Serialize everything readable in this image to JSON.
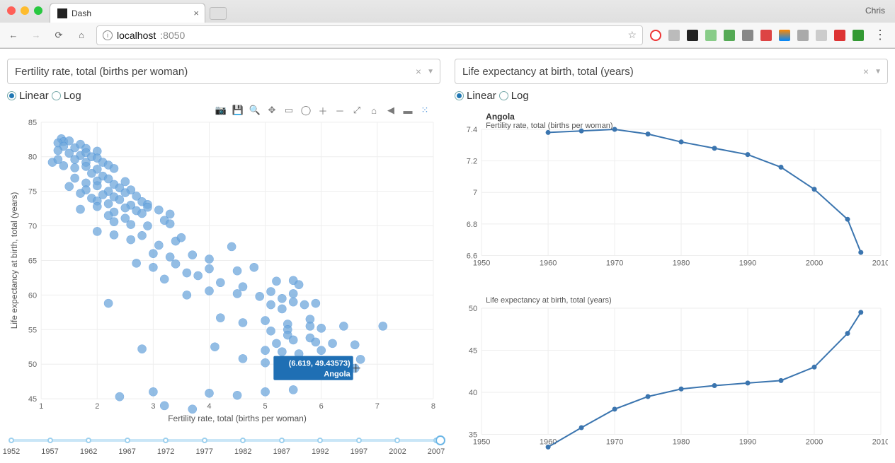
{
  "browser": {
    "tab_title": "Dash",
    "user": "Chris",
    "url_host": "localhost",
    "url_port": ":8050"
  },
  "left": {
    "dropdown": "Fertility rate, total (births per woman)",
    "radio_linear": "Linear",
    "radio_log": "Log",
    "xlabel": "Fertility rate, total (births per woman)",
    "ylabel": "Life expectancy at birth, total (years)",
    "tooltip_line1": "(6.619, 49.43573)",
    "tooltip_line2": "Angola"
  },
  "right": {
    "dropdown": "Life expectancy at birth, total (years)",
    "radio_linear": "Linear",
    "radio_log": "Log",
    "country": "Angola",
    "sub_fert": "Fertility rate, total (births per woman)",
    "sub_life": "Life expectancy at birth, total (years)"
  },
  "slider": {
    "labels": [
      "1952",
      "1957",
      "1962",
      "1967",
      "1972",
      "1977",
      "1982",
      "1987",
      "1992",
      "1997",
      "2002",
      "2007"
    ],
    "selected_index": 11
  },
  "chart_data": [
    {
      "type": "scatter",
      "title": "",
      "xlabel": "Fertility rate, total (births per woman)",
      "ylabel": "Life expectancy at birth, total (years)",
      "xlim": [
        1,
        8
      ],
      "ylim": [
        45,
        85
      ],
      "xticks": [
        1,
        2,
        3,
        4,
        5,
        6,
        7,
        8
      ],
      "yticks": [
        45,
        50,
        55,
        60,
        65,
        70,
        75,
        80,
        85
      ],
      "highlight": {
        "name": "Angola",
        "x": 6.619,
        "y": 49.43573
      },
      "points": [
        [
          1.36,
          82.6
        ],
        [
          1.4,
          82.2
        ],
        [
          1.3,
          82.0
        ],
        [
          1.5,
          82.3
        ],
        [
          1.4,
          81.5
        ],
        [
          1.6,
          81.3
        ],
        [
          1.7,
          81.8
        ],
        [
          1.8,
          81.2
        ],
        [
          1.3,
          80.9
        ],
        [
          1.5,
          80.5
        ],
        [
          1.7,
          80.2
        ],
        [
          1.8,
          80.6
        ],
        [
          2.0,
          80.8
        ],
        [
          1.9,
          80.0
        ],
        [
          1.2,
          79.2
        ],
        [
          1.3,
          79.6
        ],
        [
          1.6,
          79.6
        ],
        [
          1.8,
          79.2
        ],
        [
          2.0,
          79.8
        ],
        [
          2.1,
          79.2
        ],
        [
          1.4,
          78.7
        ],
        [
          1.6,
          78.4
        ],
        [
          1.8,
          78.6
        ],
        [
          2.0,
          78.2
        ],
        [
          2.2,
          78.8
        ],
        [
          2.3,
          78.3
        ],
        [
          1.9,
          77.6
        ],
        [
          2.1,
          77.2
        ],
        [
          1.6,
          76.9
        ],
        [
          1.8,
          76.2
        ],
        [
          2.0,
          76.5
        ],
        [
          2.2,
          76.8
        ],
        [
          2.3,
          76.0
        ],
        [
          2.5,
          76.4
        ],
        [
          1.5,
          75.7
        ],
        [
          1.8,
          75.2
        ],
        [
          2.0,
          75.8
        ],
        [
          2.2,
          75.0
        ],
        [
          2.4,
          75.5
        ],
        [
          2.6,
          75.2
        ],
        [
          1.7,
          74.7
        ],
        [
          1.9,
          74.0
        ],
        [
          2.1,
          74.5
        ],
        [
          2.3,
          74.2
        ],
        [
          2.5,
          74.8
        ],
        [
          2.7,
          74.3
        ],
        [
          2.0,
          73.6
        ],
        [
          2.2,
          73.2
        ],
        [
          2.4,
          73.8
        ],
        [
          2.6,
          73.0
        ],
        [
          2.8,
          73.5
        ],
        [
          2.9,
          73.1
        ],
        [
          1.7,
          72.4
        ],
        [
          2.0,
          72.8
        ],
        [
          2.3,
          72.0
        ],
        [
          2.5,
          72.6
        ],
        [
          2.7,
          72.2
        ],
        [
          2.9,
          72.7
        ],
        [
          3.1,
          72.3
        ],
        [
          3.3,
          71.7
        ],
        [
          2.2,
          71.5
        ],
        [
          2.5,
          71.1
        ],
        [
          2.8,
          71.8
        ],
        [
          2.3,
          70.6
        ],
        [
          2.6,
          70.2
        ],
        [
          2.9,
          70.0
        ],
        [
          3.2,
          70.8
        ],
        [
          3.3,
          70.3
        ],
        [
          2.0,
          69.2
        ],
        [
          2.3,
          68.7
        ],
        [
          2.6,
          68.0
        ],
        [
          2.8,
          68.6
        ],
        [
          3.1,
          67.2
        ],
        [
          3.4,
          67.8
        ],
        [
          3.5,
          68.3
        ],
        [
          3.0,
          66.0
        ],
        [
          3.3,
          65.5
        ],
        [
          3.7,
          65.8
        ],
        [
          2.7,
          64.6
        ],
        [
          3.0,
          64.0
        ],
        [
          3.4,
          64.5
        ],
        [
          4.0,
          65.2
        ],
        [
          4.4,
          67.0
        ],
        [
          3.6,
          63.2
        ],
        [
          4.0,
          63.8
        ],
        [
          3.2,
          62.3
        ],
        [
          3.8,
          62.8
        ],
        [
          4.5,
          63.5
        ],
        [
          4.8,
          64.0
        ],
        [
          4.2,
          61.8
        ],
        [
          4.6,
          61.2
        ],
        [
          5.2,
          62.0
        ],
        [
          5.5,
          62.1
        ],
        [
          5.6,
          61.5
        ],
        [
          3.6,
          60.0
        ],
        [
          4.0,
          60.6
        ],
        [
          4.5,
          60.2
        ],
        [
          4.9,
          59.8
        ],
        [
          5.1,
          60.5
        ],
        [
          5.3,
          59.5
        ],
        [
          5.5,
          60.2
        ],
        [
          5.5,
          59.0
        ],
        [
          5.1,
          58.6
        ],
        [
          5.3,
          58.0
        ],
        [
          5.7,
          58.6
        ],
        [
          5.9,
          58.8
        ],
        [
          2.2,
          58.8
        ],
        [
          4.2,
          56.7
        ],
        [
          4.6,
          56.0
        ],
        [
          5.0,
          56.3
        ],
        [
          5.4,
          55.8
        ],
        [
          5.8,
          56.5
        ],
        [
          5.4,
          55.0
        ],
        [
          5.8,
          55.5
        ],
        [
          6.0,
          55.2
        ],
        [
          6.4,
          55.5
        ],
        [
          7.1,
          55.5
        ],
        [
          5.1,
          54.8
        ],
        [
          5.4,
          54.2
        ],
        [
          5.8,
          53.8
        ],
        [
          5.2,
          53.0
        ],
        [
          5.5,
          53.5
        ],
        [
          5.9,
          53.2
        ],
        [
          6.2,
          53.0
        ],
        [
          6.6,
          52.8
        ],
        [
          4.1,
          52.5
        ],
        [
          5.0,
          52.0
        ],
        [
          5.3,
          51.8
        ],
        [
          5.6,
          51.5
        ],
        [
          6.0,
          52.0
        ],
        [
          4.6,
          50.8
        ],
        [
          5.0,
          50.2
        ],
        [
          5.4,
          49.8
        ],
        [
          6.1,
          50.0
        ],
        [
          6.6,
          49.4
        ],
        [
          6.3,
          48.5
        ],
        [
          6.7,
          50.7
        ],
        [
          2.8,
          52.2
        ],
        [
          3.0,
          46.0
        ],
        [
          4.0,
          45.8
        ],
        [
          4.5,
          45.5
        ],
        [
          5.0,
          46.0
        ],
        [
          5.5,
          46.3
        ],
        [
          2.4,
          45.3
        ],
        [
          3.2,
          44.0
        ],
        [
          3.7,
          43.5
        ]
      ]
    },
    {
      "type": "line",
      "title": "Angola — Fertility rate, total (births per woman)",
      "xlabel": "",
      "ylabel": "",
      "xlim": [
        1950,
        2010
      ],
      "ylim": [
        6.6,
        7.4
      ],
      "xticks": [
        1950,
        1960,
        1970,
        1980,
        1990,
        2000,
        2010
      ],
      "yticks": [
        6.6,
        6.8,
        7.0,
        7.2,
        7.4
      ],
      "x": [
        1960,
        1965,
        1970,
        1975,
        1980,
        1985,
        1990,
        1995,
        2000,
        2005,
        2007
      ],
      "y": [
        7.38,
        7.39,
        7.4,
        7.37,
        7.32,
        7.28,
        7.24,
        7.16,
        7.02,
        6.83,
        6.62
      ]
    },
    {
      "type": "line",
      "title": "Angola — Life expectancy at birth, total (years)",
      "xlabel": "",
      "ylabel": "",
      "xlim": [
        1950,
        2010
      ],
      "ylim": [
        35,
        50
      ],
      "xticks": [
        1950,
        1960,
        1970,
        1980,
        1990,
        2000,
        2010
      ],
      "yticks": [
        35,
        40,
        45,
        50
      ],
      "x": [
        1960,
        1965,
        1970,
        1975,
        1980,
        1985,
        1990,
        1995,
        2000,
        2005,
        2007
      ],
      "y": [
        33.5,
        35.8,
        38.0,
        39.5,
        40.4,
        40.8,
        41.1,
        41.4,
        43.0,
        47.0,
        49.5
      ]
    }
  ]
}
